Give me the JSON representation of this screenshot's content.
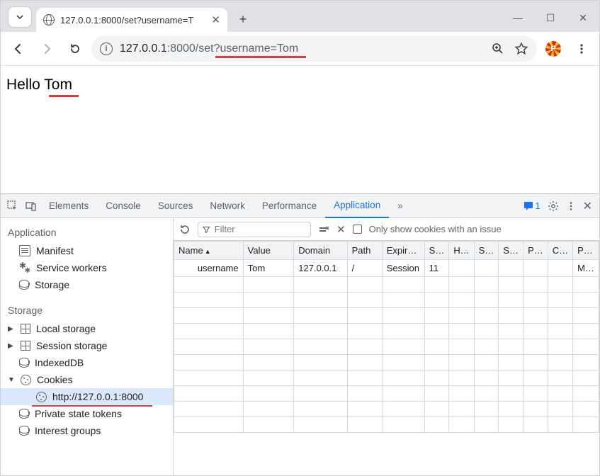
{
  "browser": {
    "tab_title": "127.0.0.1:8000/set?username=T",
    "url_host": "127.0.0.1",
    "url_port": ":8000",
    "url_path": "/set?username=Tom"
  },
  "page": {
    "greeting": "Hello Tom"
  },
  "devtools": {
    "tabs": [
      "Elements",
      "Console",
      "Sources",
      "Network",
      "Performance",
      "Application"
    ],
    "active_tab": "Application",
    "more_glyph": "»",
    "issues_count": "1",
    "sidebar": {
      "app_header": "Application",
      "app_items": [
        "Manifest",
        "Service workers",
        "Storage"
      ],
      "storage_header": "Storage",
      "storage_items": [
        "Local storage",
        "Session storage",
        "IndexedDB",
        "Cookies",
        "Private state tokens",
        "Interest groups"
      ],
      "cookies_origin": "http://127.0.0.1:8000"
    },
    "cookies": {
      "filter_placeholder": "Filter",
      "only_issue_label": "Only show cookies with an issue",
      "columns": [
        "Name",
        "Value",
        "Domain",
        "Path",
        "Expir…",
        "S…",
        "H…",
        "S…",
        "S…",
        "P…",
        "C…",
        "P…"
      ],
      "rows": [
        {
          "name": "username",
          "value": "Tom",
          "domain": "127.0.0.1",
          "path": "/",
          "expires": "Session",
          "size": "11",
          "http": "",
          "secure": "",
          "same": "",
          "part": "",
          "cross": "",
          "prio": "M…"
        }
      ]
    }
  }
}
